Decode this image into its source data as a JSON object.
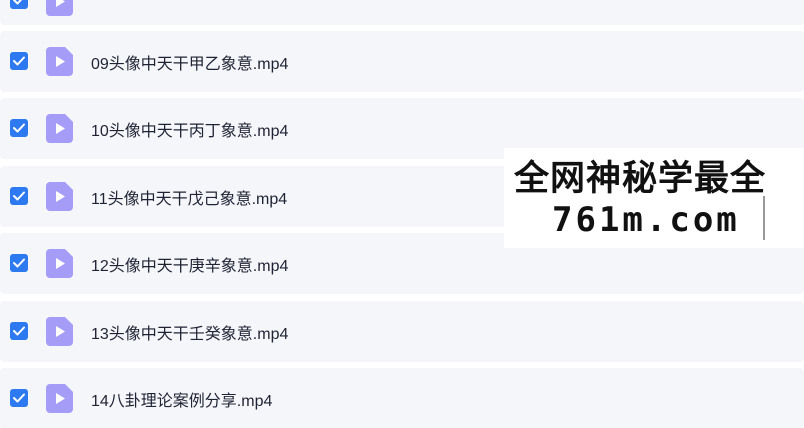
{
  "files": [
    {
      "name": "",
      "checked": true,
      "partial": true
    },
    {
      "name": "09头像中天干甲乙象意.mp4",
      "checked": true
    },
    {
      "name": "10头像中天干丙丁象意.mp4",
      "checked": true
    },
    {
      "name": "11头像中天干戊己象意.mp4",
      "checked": true
    },
    {
      "name": "12头像中天干庚辛象意.mp4",
      "checked": true
    },
    {
      "name": "13头像中天干壬癸象意.mp4",
      "checked": true
    },
    {
      "name": "14八卦理论案例分享.mp4",
      "checked": true
    }
  ],
  "watermark": {
    "line1": "全网神秘学最全",
    "line2": "761m.com"
  },
  "colors": {
    "checkbox": "#2d7af0",
    "file_icon": "#a59cf8",
    "row_bg": "#f5f6fa"
  },
  "icons": {
    "checkbox": "check-icon",
    "file": "video-file-icon"
  }
}
